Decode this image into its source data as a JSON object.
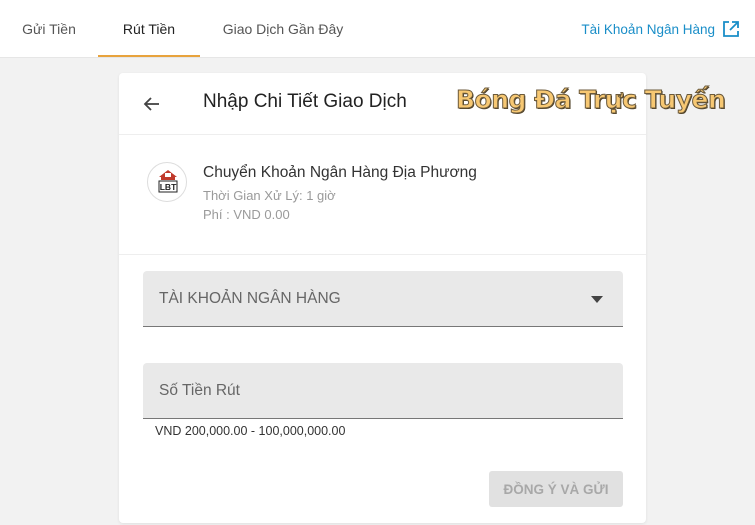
{
  "tabs": [
    {
      "label": "Gửi Tiền",
      "active": false
    },
    {
      "label": "Rút Tiền",
      "active": true
    },
    {
      "label": "Giao Dịch Gần Đây",
      "active": false
    }
  ],
  "header_link": {
    "label": "Tài Khoản Ngân Hàng",
    "icon": "external-link-icon"
  },
  "card": {
    "title": "Nhập Chi Tiết Giao Dịch",
    "back_icon": "arrow-left-icon"
  },
  "watermark": "Bóng Đá Trực Tuyến",
  "method": {
    "logo_text": "LBT",
    "name": "Chuyển Khoản Ngân Hàng Địa Phương",
    "processing_time": "Thời Gian Xử Lý: 1 giờ",
    "fee": "Phí : VND 0.00"
  },
  "form": {
    "bank_account_label": "TÀI KHOẢN NGÂN HÀNG",
    "amount_placeholder": "Số Tiền Rút",
    "amount_range": "VND 200,000.00 - 100,000,000.00",
    "submit_label": "ĐỒNG Ý VÀ GỬI",
    "submit_enabled": false
  },
  "colors": {
    "accent": "#e8a33d",
    "link": "#1a8ec8",
    "field_bg": "#e9e9e9",
    "disabled_button": "#e1e1e1"
  }
}
